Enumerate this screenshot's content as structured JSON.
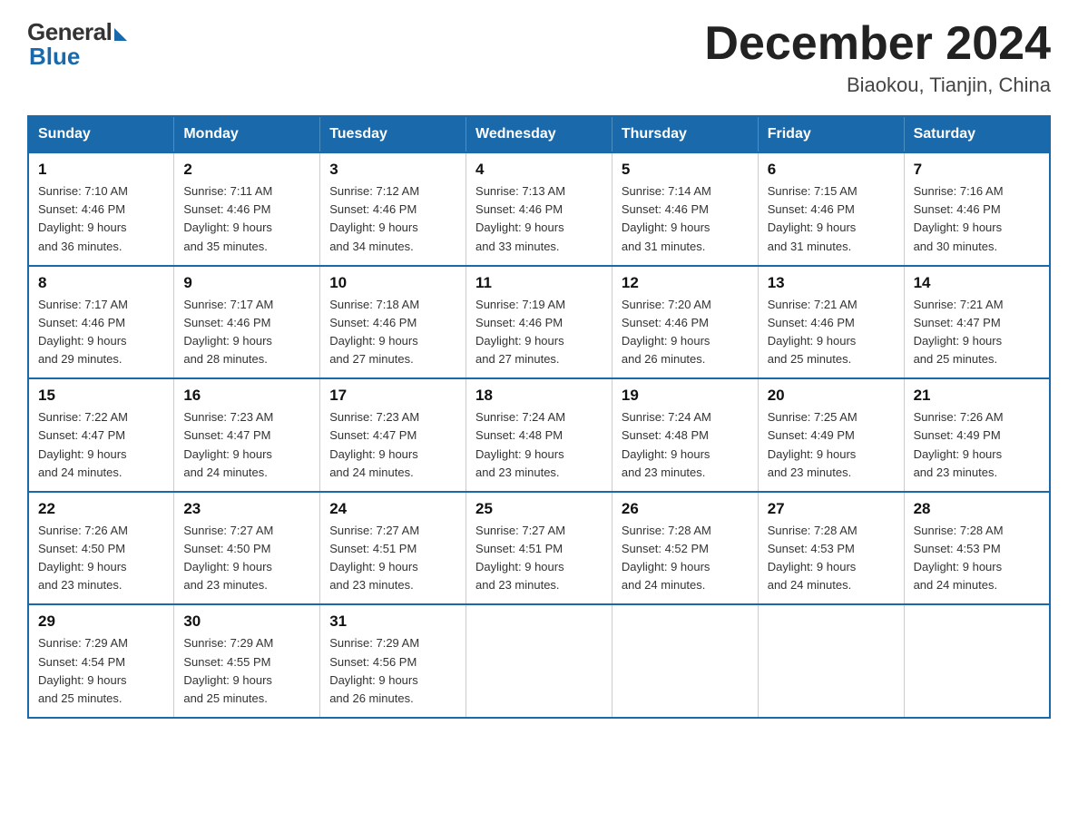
{
  "logo": {
    "general": "General",
    "blue": "Blue"
  },
  "title": "December 2024",
  "location": "Biaokou, Tianjin, China",
  "days_header": [
    "Sunday",
    "Monday",
    "Tuesday",
    "Wednesday",
    "Thursday",
    "Friday",
    "Saturday"
  ],
  "weeks": [
    [
      {
        "day": "1",
        "sunrise": "7:10 AM",
        "sunset": "4:46 PM",
        "daylight": "9 hours and 36 minutes."
      },
      {
        "day": "2",
        "sunrise": "7:11 AM",
        "sunset": "4:46 PM",
        "daylight": "9 hours and 35 minutes."
      },
      {
        "day": "3",
        "sunrise": "7:12 AM",
        "sunset": "4:46 PM",
        "daylight": "9 hours and 34 minutes."
      },
      {
        "day": "4",
        "sunrise": "7:13 AM",
        "sunset": "4:46 PM",
        "daylight": "9 hours and 33 minutes."
      },
      {
        "day": "5",
        "sunrise": "7:14 AM",
        "sunset": "4:46 PM",
        "daylight": "9 hours and 31 minutes."
      },
      {
        "day": "6",
        "sunrise": "7:15 AM",
        "sunset": "4:46 PM",
        "daylight": "9 hours and 31 minutes."
      },
      {
        "day": "7",
        "sunrise": "7:16 AM",
        "sunset": "4:46 PM",
        "daylight": "9 hours and 30 minutes."
      }
    ],
    [
      {
        "day": "8",
        "sunrise": "7:17 AM",
        "sunset": "4:46 PM",
        "daylight": "9 hours and 29 minutes."
      },
      {
        "day": "9",
        "sunrise": "7:17 AM",
        "sunset": "4:46 PM",
        "daylight": "9 hours and 28 minutes."
      },
      {
        "day": "10",
        "sunrise": "7:18 AM",
        "sunset": "4:46 PM",
        "daylight": "9 hours and 27 minutes."
      },
      {
        "day": "11",
        "sunrise": "7:19 AM",
        "sunset": "4:46 PM",
        "daylight": "9 hours and 27 minutes."
      },
      {
        "day": "12",
        "sunrise": "7:20 AM",
        "sunset": "4:46 PM",
        "daylight": "9 hours and 26 minutes."
      },
      {
        "day": "13",
        "sunrise": "7:21 AM",
        "sunset": "4:46 PM",
        "daylight": "9 hours and 25 minutes."
      },
      {
        "day": "14",
        "sunrise": "7:21 AM",
        "sunset": "4:47 PM",
        "daylight": "9 hours and 25 minutes."
      }
    ],
    [
      {
        "day": "15",
        "sunrise": "7:22 AM",
        "sunset": "4:47 PM",
        "daylight": "9 hours and 24 minutes."
      },
      {
        "day": "16",
        "sunrise": "7:23 AM",
        "sunset": "4:47 PM",
        "daylight": "9 hours and 24 minutes."
      },
      {
        "day": "17",
        "sunrise": "7:23 AM",
        "sunset": "4:47 PM",
        "daylight": "9 hours and 24 minutes."
      },
      {
        "day": "18",
        "sunrise": "7:24 AM",
        "sunset": "4:48 PM",
        "daylight": "9 hours and 23 minutes."
      },
      {
        "day": "19",
        "sunrise": "7:24 AM",
        "sunset": "4:48 PM",
        "daylight": "9 hours and 23 minutes."
      },
      {
        "day": "20",
        "sunrise": "7:25 AM",
        "sunset": "4:49 PM",
        "daylight": "9 hours and 23 minutes."
      },
      {
        "day": "21",
        "sunrise": "7:26 AM",
        "sunset": "4:49 PM",
        "daylight": "9 hours and 23 minutes."
      }
    ],
    [
      {
        "day": "22",
        "sunrise": "7:26 AM",
        "sunset": "4:50 PM",
        "daylight": "9 hours and 23 minutes."
      },
      {
        "day": "23",
        "sunrise": "7:27 AM",
        "sunset": "4:50 PM",
        "daylight": "9 hours and 23 minutes."
      },
      {
        "day": "24",
        "sunrise": "7:27 AM",
        "sunset": "4:51 PM",
        "daylight": "9 hours and 23 minutes."
      },
      {
        "day": "25",
        "sunrise": "7:27 AM",
        "sunset": "4:51 PM",
        "daylight": "9 hours and 23 minutes."
      },
      {
        "day": "26",
        "sunrise": "7:28 AM",
        "sunset": "4:52 PM",
        "daylight": "9 hours and 24 minutes."
      },
      {
        "day": "27",
        "sunrise": "7:28 AM",
        "sunset": "4:53 PM",
        "daylight": "9 hours and 24 minutes."
      },
      {
        "day": "28",
        "sunrise": "7:28 AM",
        "sunset": "4:53 PM",
        "daylight": "9 hours and 24 minutes."
      }
    ],
    [
      {
        "day": "29",
        "sunrise": "7:29 AM",
        "sunset": "4:54 PM",
        "daylight": "9 hours and 25 minutes."
      },
      {
        "day": "30",
        "sunrise": "7:29 AM",
        "sunset": "4:55 PM",
        "daylight": "9 hours and 25 minutes."
      },
      {
        "day": "31",
        "sunrise": "7:29 AM",
        "sunset": "4:56 PM",
        "daylight": "9 hours and 26 minutes."
      },
      null,
      null,
      null,
      null
    ]
  ],
  "labels": {
    "sunrise": "Sunrise: ",
    "sunset": "Sunset: ",
    "daylight": "Daylight: "
  }
}
